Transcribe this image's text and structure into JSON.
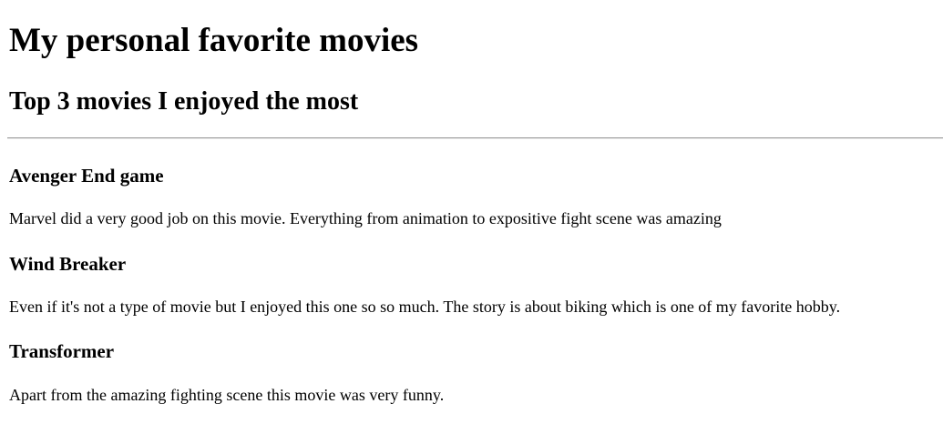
{
  "page": {
    "title": "My personal favorite movies",
    "subtitle": "Top 3 movies I enjoyed the most"
  },
  "movies": [
    {
      "title": "Avenger End game",
      "description": "Marvel did a very good job on this movie. Everything from animation to expositive fight scene was amazing"
    },
    {
      "title": "Wind Breaker",
      "description": "Even if it's not a type of movie but I enjoyed this one so so much. The story is about biking which is one of my favorite hobby."
    },
    {
      "title": "Transformer",
      "description": "Apart from the amazing fighting scene this movie was very funny."
    }
  ]
}
